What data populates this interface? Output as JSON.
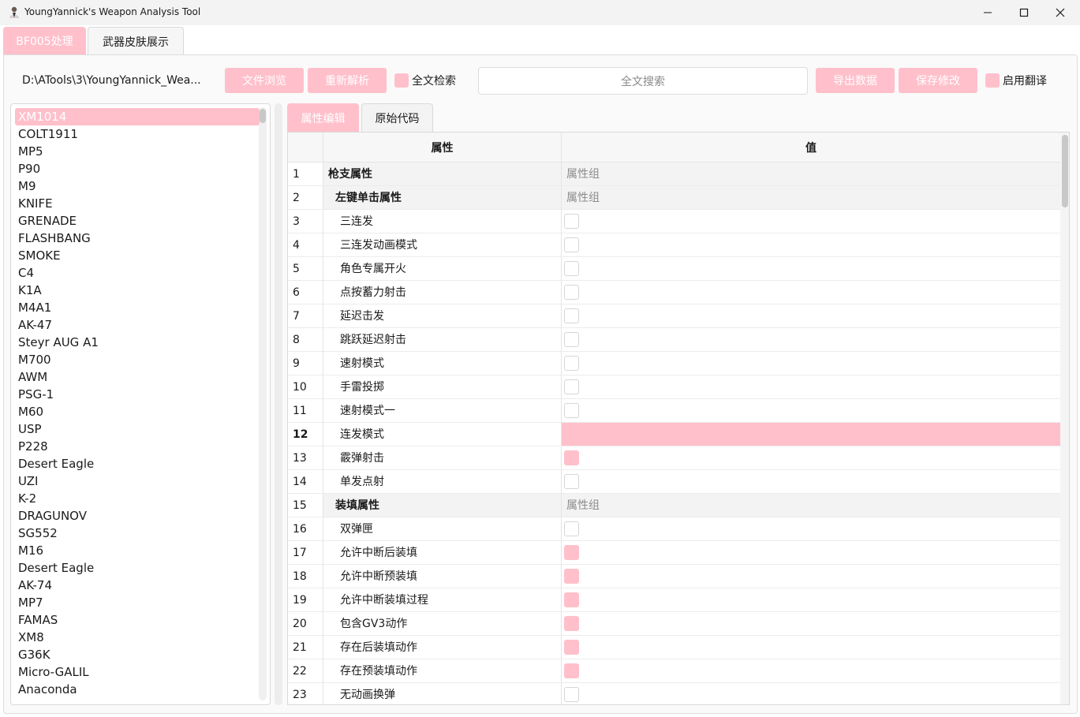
{
  "window": {
    "title": "YoungYannick's Weapon Analysis Tool",
    "icon": "avatar-icon"
  },
  "top_tabs": [
    {
      "label": "BF005处理",
      "active": true
    },
    {
      "label": "武器皮肤展示",
      "active": false
    }
  ],
  "toolbar": {
    "path": "D:\\ATools\\3\\YoungYannick_Wea...",
    "browse_label": "文件浏览",
    "reparse_label": "重新解析",
    "fulltext_check_label": "全文检索",
    "search_placeholder": "全文搜索",
    "export_label": "导出数据",
    "save_label": "保存修改",
    "translate_check_label": "启用翻译"
  },
  "weapon_list": {
    "items": [
      "XM1014",
      "COLT1911",
      "MP5",
      "P90",
      "M9",
      "KNIFE",
      "GRENADE",
      "FLASHBANG",
      "SMOKE",
      "C4",
      "K1A",
      "M4A1",
      "AK-47",
      "Steyr AUG A1",
      "M700",
      "AWM",
      "PSG-1",
      "M60",
      "USP",
      "P228",
      "Desert Eagle",
      "UZI",
      "K-2",
      "DRAGUNOV",
      "SG552",
      "M16",
      "Desert Eagle",
      "AK-74",
      "MP7",
      "FAMAS",
      "XM8",
      "G36K",
      "Micro-GALIL",
      "Anaconda"
    ],
    "selected": "XM1014"
  },
  "inner_tabs": [
    {
      "label": "属性编辑",
      "active": true
    },
    {
      "label": "原始代码",
      "active": false
    }
  ],
  "table": {
    "headers": {
      "attribute": "属性",
      "value": "值"
    },
    "group_text": "属性组",
    "rows": [
      {
        "n": "1",
        "name": "枪支属性",
        "level": 0,
        "type": "group"
      },
      {
        "n": "2",
        "name": "左键单击属性",
        "level": 1,
        "type": "group"
      },
      {
        "n": "3",
        "name": "三连发",
        "level": 2,
        "type": "check",
        "checked": false
      },
      {
        "n": "4",
        "name": "三连发动画模式",
        "level": 2,
        "type": "check",
        "checked": false
      },
      {
        "n": "5",
        "name": "角色专属开火",
        "level": 2,
        "type": "check",
        "checked": false
      },
      {
        "n": "6",
        "name": "点按蓄力射击",
        "level": 2,
        "type": "check",
        "checked": false
      },
      {
        "n": "7",
        "name": "延迟击发",
        "level": 2,
        "type": "check",
        "checked": false
      },
      {
        "n": "8",
        "name": "跳跃延迟射击",
        "level": 2,
        "type": "check",
        "checked": false
      },
      {
        "n": "9",
        "name": "速射模式",
        "level": 2,
        "type": "check",
        "checked": false
      },
      {
        "n": "10",
        "name": "手雷投掷",
        "level": 2,
        "type": "check",
        "checked": false
      },
      {
        "n": "11",
        "name": "速射模式一",
        "level": 2,
        "type": "check",
        "checked": false
      },
      {
        "n": "12",
        "name": "连发模式",
        "level": 2,
        "type": "selected"
      },
      {
        "n": "13",
        "name": "霰弹射击",
        "level": 2,
        "type": "check",
        "checked": true
      },
      {
        "n": "14",
        "name": "单发点射",
        "level": 2,
        "type": "check",
        "checked": false
      },
      {
        "n": "15",
        "name": "装填属性",
        "level": 1,
        "type": "group"
      },
      {
        "n": "16",
        "name": "双弹匣",
        "level": 2,
        "type": "check",
        "checked": false
      },
      {
        "n": "17",
        "name": "允许中断后装填",
        "level": 2,
        "type": "check",
        "checked": true
      },
      {
        "n": "18",
        "name": "允许中断预装填",
        "level": 2,
        "type": "check",
        "checked": true
      },
      {
        "n": "19",
        "name": "允许中断装填过程",
        "level": 2,
        "type": "check",
        "checked": true
      },
      {
        "n": "20",
        "name": "包含GV3动作",
        "level": 2,
        "type": "check",
        "checked": true
      },
      {
        "n": "21",
        "name": "存在后装填动作",
        "level": 2,
        "type": "check",
        "checked": true
      },
      {
        "n": "22",
        "name": "存在预装填动作",
        "level": 2,
        "type": "check",
        "checked": true
      },
      {
        "n": "23",
        "name": "无动画换弹",
        "level": 2,
        "type": "check",
        "checked": false
      }
    ]
  },
  "colors": {
    "accent": "#ffc0cb",
    "group_bg": "#f3f3f3",
    "header_bg": "#f7f7f7"
  }
}
